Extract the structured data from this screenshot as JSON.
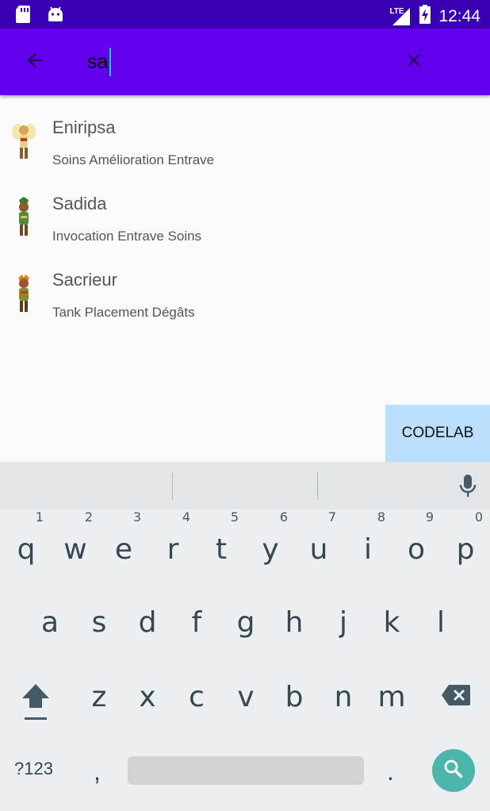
{
  "status_bar": {
    "time": "12:44",
    "network": "LTE",
    "left_icons": [
      "sd-card-icon",
      "android-icon"
    ],
    "right_icons": [
      "signal-icon",
      "battery-charging-icon"
    ]
  },
  "app_bar": {
    "back_icon": "arrow-back-icon",
    "search_value": "sa",
    "clear_icon": "close-icon",
    "background": "#6200ee"
  },
  "results": [
    {
      "title": "Eniripsa",
      "subtitle": "Soins Amélioration Entrave",
      "avatar": "eniripsa-avatar"
    },
    {
      "title": "Sadida",
      "subtitle": "Invocation Entrave Soins",
      "avatar": "sadida-avatar"
    },
    {
      "title": "Sacrieur",
      "subtitle": "Tank Placement Dégâts",
      "avatar": "sacrieur-avatar"
    }
  ],
  "codelab_button": {
    "label": "CODELAB",
    "color": "#bbdefb"
  },
  "keyboard": {
    "row1": [
      {
        "key": "q",
        "hint": "1"
      },
      {
        "key": "w",
        "hint": "2"
      },
      {
        "key": "e",
        "hint": "3"
      },
      {
        "key": "r",
        "hint": "4"
      },
      {
        "key": "t",
        "hint": "5"
      },
      {
        "key": "y",
        "hint": "6"
      },
      {
        "key": "u",
        "hint": "7"
      },
      {
        "key": "i",
        "hint": "8"
      },
      {
        "key": "o",
        "hint": "9"
      },
      {
        "key": "p",
        "hint": "0"
      }
    ],
    "row2": [
      "a",
      "s",
      "d",
      "f",
      "g",
      "h",
      "j",
      "k",
      "l"
    ],
    "row3": [
      "z",
      "x",
      "c",
      "v",
      "b",
      "n",
      "m"
    ],
    "symbols_label": "?123",
    "comma": ",",
    "period": ".",
    "action_icon": "search-icon",
    "action_color": "#4db6ac"
  }
}
